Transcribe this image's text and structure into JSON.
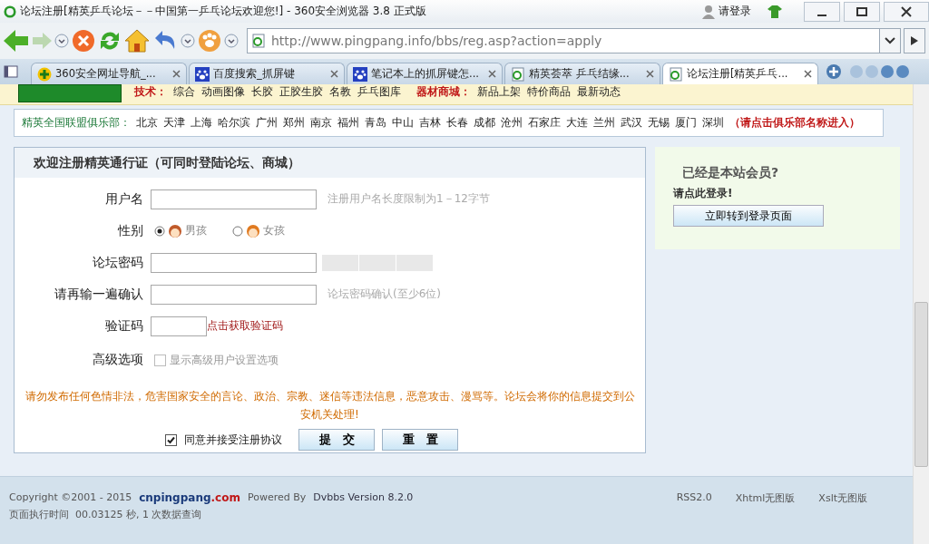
{
  "window": {
    "title": "论坛注册[精英乒乓论坛－－中国第一乒乓论坛欢迎您!] - 360安全浏览器 3.8 正式版",
    "login": "请登录"
  },
  "toolbar": {
    "url": "http://www.pingpang.info/bbs/reg.asp?action=apply"
  },
  "tabs": [
    {
      "label": "360安全网址导航_...",
      "kind": "nav",
      "selected": false
    },
    {
      "label": "百度搜索_抓屏键",
      "kind": "paw",
      "selected": false
    },
    {
      "label": "笔记本上的抓屏键怎...",
      "kind": "paw",
      "selected": false
    },
    {
      "label": "精英荟萃 乒乓结缘...",
      "kind": "page",
      "selected": false
    },
    {
      "label": "论坛注册[精英乒乓...",
      "kind": "page",
      "selected": true
    }
  ],
  "header": {
    "tech_label": "技术：",
    "tech_links": [
      "综合",
      "动画图像",
      "长胶",
      "正胶生胶",
      "名教",
      "乒乓图库"
    ],
    "shop_label": "器材商城：",
    "shop_links": [
      "新品上架",
      "特价商品",
      "最新动态"
    ]
  },
  "clubs": {
    "label": "精英全国联盟俱乐部：",
    "cities": [
      "北京",
      "天津",
      "上海",
      "哈尔滨",
      "广州",
      "郑州",
      "南京",
      "福州",
      "青岛",
      "中山",
      "吉林",
      "长春",
      "成都",
      "沧州",
      "石家庄",
      "大连",
      "兰州",
      "武汉",
      "无锡",
      "厦门",
      "深圳"
    ],
    "hint": "（请点击俱乐部名称进入）"
  },
  "form": {
    "title": "欢迎注册精英通行证（可同时登陆论坛、商城）",
    "fields": [
      {
        "kind": "text",
        "label": "用户名",
        "hint": "注册用户名长度限制为1－12字节"
      },
      {
        "kind": "radio",
        "label": "性别",
        "options": [
          {
            "label": "男孩",
            "selected": true
          },
          {
            "label": "女孩",
            "selected": false
          }
        ]
      },
      {
        "kind": "password",
        "label": "论坛密码"
      },
      {
        "kind": "text",
        "label": "请再输一遍确认",
        "hint": "论坛密码确认(至少6位)"
      },
      {
        "kind": "captcha",
        "label": "验证码",
        "link": "点击获取验证码"
      },
      {
        "kind": "checkbox",
        "label": "高级选项",
        "option": "显示高级用户设置选项",
        "checked": false
      }
    ],
    "warning": "请勿发布任何色情非法，危害国家安全的言论、政治、宗教、迷信等违法信息，恶意攻击、漫骂等。论坛会将你的信息提交到公安机关处理!",
    "agree": {
      "label": "同意并接受注册协议",
      "checked": true
    },
    "buttons": [
      "提　交",
      "重　置"
    ]
  },
  "side": {
    "title": "已经是本站会员?",
    "prompt": "请点此登录!",
    "button": "立即转到登录页面"
  },
  "footer": {
    "copyright": "Copyright ©2001 - 2015",
    "site_name": "cnpingpang",
    "site_tld": ".com",
    "powered": "Powered By",
    "version": "Dvbbs Version 8.2.0",
    "exec": "页面执行时间  00.03125 秒, 1 次数据查询",
    "links": [
      "RSS2.0",
      "Xhtml无图版",
      "Xslt无图版"
    ]
  }
}
